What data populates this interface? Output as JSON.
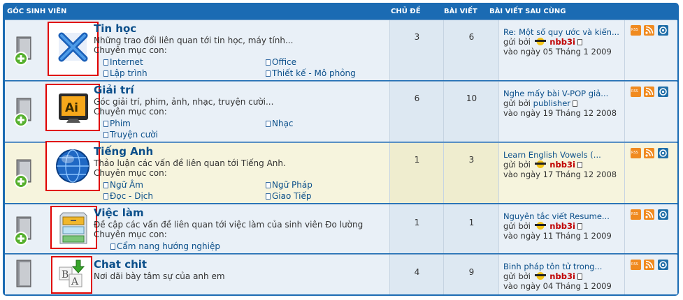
{
  "header": {
    "section_title": "GÓC SINH VIÊN",
    "col_topics": "CHỦ ĐỀ",
    "col_posts": "BÀI VIẾT",
    "col_last_post": "BÀI VIẾT SAU CÙNG"
  },
  "forums": [
    {
      "title": "Tin học",
      "description": "Những trao đổi liên quan tới tin học, máy tính...",
      "subforums_label": "Chuyên mục con:",
      "subforums": [
        "Internet",
        "Office",
        "Lập trình",
        "Thiết kế - Mô phỏng"
      ],
      "topics": "3",
      "posts": "6",
      "last_post_title": "Re: Một số quy ước và kiến...",
      "by_label": "gửi bởi",
      "last_post_user": "nbb3i",
      "last_post_date": "vào ngày 05 Tháng 1 2009",
      "icon": "blue-x-icon"
    },
    {
      "title": "Giải trí",
      "description": "Góc giải trí, phim, ảnh, nhạc, truyện cười...",
      "subforums_label": "Chuyên mục con:",
      "subforums": [
        "Phim",
        "Nhạc",
        "Truyện cười"
      ],
      "topics": "6",
      "posts": "10",
      "last_post_title": "Nghe mấy bài V-POP giả...",
      "by_label": "gửi bởi",
      "last_post_user": "publisher",
      "last_post_date": "vào ngày 19 Tháng 12 2008",
      "icon": "illustrator-icon"
    },
    {
      "title": "Tiếng Anh",
      "description": "Thảo luận các vấn đề liên quan tới Tiếng Anh.",
      "subforums_label": "Chuyên mục con:",
      "subforums": [
        "Ngữ Âm",
        "Ngữ Pháp",
        "Đọc - Dịch",
        "Giao Tiếp"
      ],
      "topics": "1",
      "posts": "3",
      "last_post_title": "Learn English Vowels (...",
      "by_label": "gửi bởi",
      "last_post_user": "nbb3i",
      "last_post_date": "vào ngày 17 Tháng 12 2008",
      "icon": "globe-icon"
    },
    {
      "title": "Việc làm",
      "description": "Đề cập các vấn đề liên quan tới việc làm của sinh viên Đo lường",
      "subforums_label": "Chuyên mục con:",
      "subforums": [
        "Cẩm nang hướng nghiệp"
      ],
      "topics": "1",
      "posts": "1",
      "last_post_title": "Nguyên tắc viết Resume...",
      "by_label": "gửi bởi",
      "last_post_user": "nbb3i",
      "last_post_date": "vào ngày 11 Tháng 1 2009",
      "icon": "filing-cabinet-icon"
    },
    {
      "title": "Chat chit",
      "description": "Nơi dãi bày tâm sự của anh em",
      "subforums_label": "",
      "subforums": [],
      "topics": "4",
      "posts": "9",
      "last_post_title": "Binh pháp tôn tử trong...",
      "by_label": "gửi bởi",
      "last_post_user": "nbb3i",
      "last_post_date": "vào ngày 04 Tháng 1 2009",
      "icon": "font-conversion-icon"
    }
  ],
  "feed_icons": {
    "rss_label": "RSS",
    "icons": [
      "rss-badge-icon",
      "rss-feed-icon",
      "target-icon"
    ]
  }
}
